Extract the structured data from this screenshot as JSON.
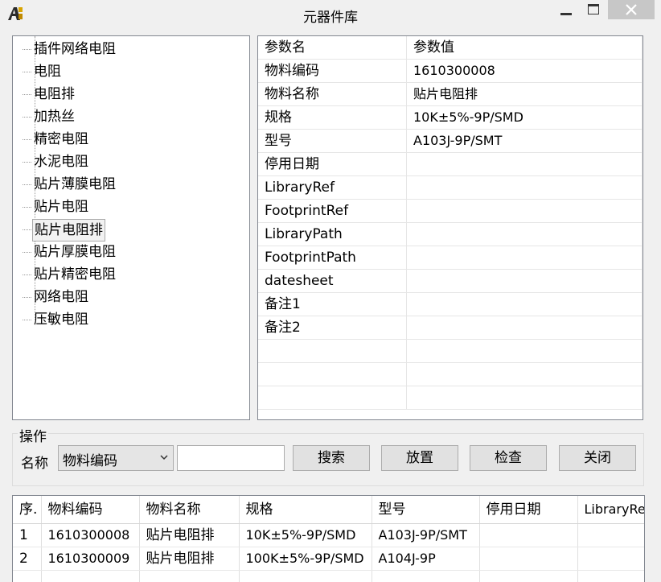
{
  "window": {
    "title": "元器件库",
    "app_icon": "app-logo-icon",
    "controls": [
      "minimize-icon",
      "maximize-icon",
      "close-icon"
    ]
  },
  "tree": {
    "items": [
      {
        "label": "插件网络电阻",
        "selected": false
      },
      {
        "label": "电阻",
        "selected": false
      },
      {
        "label": "电阻排",
        "selected": false
      },
      {
        "label": "加热丝",
        "selected": false
      },
      {
        "label": "精密电阻",
        "selected": false
      },
      {
        "label": "水泥电阻",
        "selected": false
      },
      {
        "label": "贴片薄膜电阻",
        "selected": false
      },
      {
        "label": "贴片电阻",
        "selected": false
      },
      {
        "label": "贴片电阻排",
        "selected": true
      },
      {
        "label": "贴片厚膜电阻",
        "selected": false
      },
      {
        "label": "贴片精密电阻",
        "selected": false
      },
      {
        "label": "网络电阻",
        "selected": false
      },
      {
        "label": "压敏电阻",
        "selected": false
      }
    ]
  },
  "params": {
    "headers": [
      "参数名",
      "参数值"
    ],
    "rows": [
      {
        "name": "物料编码",
        "value": "1610300008"
      },
      {
        "name": "物料名称",
        "value": "贴片电阻排"
      },
      {
        "name": "规格",
        "value": "10K±5%-9P/SMD"
      },
      {
        "name": "型号",
        "value": "A103J-9P/SMT"
      },
      {
        "name": "停用日期",
        "value": ""
      },
      {
        "name": "LibraryRef",
        "value": ""
      },
      {
        "name": "FootprintRef",
        "value": ""
      },
      {
        "name": "LibraryPath",
        "value": ""
      },
      {
        "name": "FootprintPath",
        "value": ""
      },
      {
        "name": "datesheet",
        "value": ""
      },
      {
        "name": "备注1",
        "value": ""
      },
      {
        "name": "备注2",
        "value": ""
      },
      {
        "name": "",
        "value": ""
      },
      {
        "name": "",
        "value": ""
      },
      {
        "name": "",
        "value": ""
      }
    ]
  },
  "ops": {
    "legend": "操作",
    "name_label": "名称",
    "field_select": {
      "value": "物料编码"
    },
    "search_input": {
      "value": "",
      "placeholder": ""
    },
    "buttons": {
      "search": "搜索",
      "place": "放置",
      "check": "检查",
      "close": "关闭"
    }
  },
  "results": {
    "headers": [
      "序.",
      "物料编码",
      "物料名称",
      "规格",
      "型号",
      "停用日期",
      "LibraryRef"
    ],
    "rows": [
      [
        "1",
        "1610300008",
        "贴片电阻排",
        "10K±5%-9P/SMD",
        "A103J-9P/SMT",
        "",
        ""
      ],
      [
        "2",
        "1610300009",
        "贴片电阻排",
        "100K±5%-9P/SMD",
        "A104J-9P",
        "",
        ""
      ],
      [
        "",
        "",
        "",
        "",
        "",
        "",
        ""
      ]
    ]
  }
}
